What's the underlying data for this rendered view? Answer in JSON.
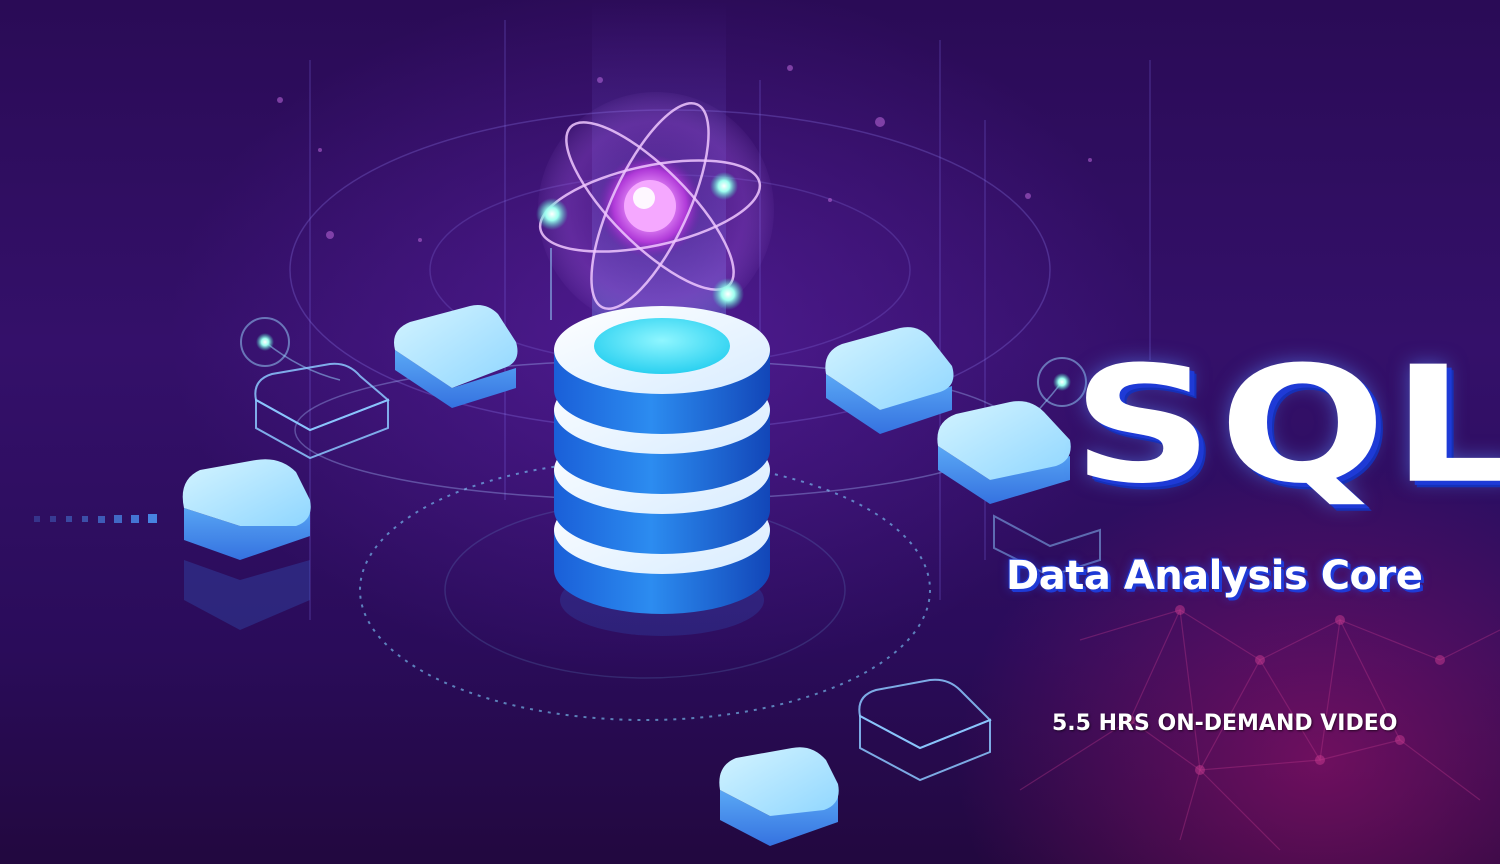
{
  "logo": {
    "text": "SQL"
  },
  "subtitle": "Data Analysis Core",
  "duration_label": "5.5 HRS ON-DEMAND VIDEO",
  "colors": {
    "background": "#2a0b56",
    "accent_blue": "#1e3ad6",
    "cyan": "#6fe0ff",
    "magenta_glow": "#b040d0"
  },
  "icons": [
    "database-icon",
    "atom-icon"
  ]
}
